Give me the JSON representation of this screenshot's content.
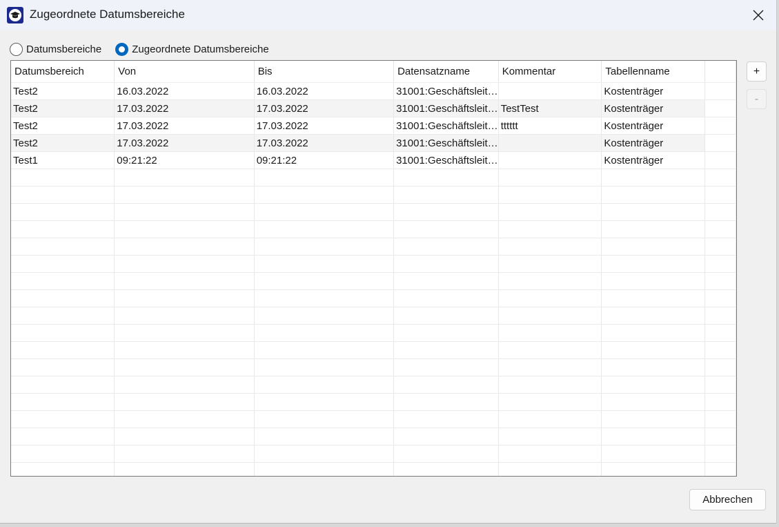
{
  "window": {
    "title": "Zugeordnete Datumsbereiche",
    "accent_color": "#0067c0"
  },
  "mode": {
    "options": [
      {
        "label": "Datumsbereiche",
        "checked": false
      },
      {
        "label": "Zugeordnete Datumsbereiche",
        "checked": true
      }
    ]
  },
  "table": {
    "columns": [
      "Datumsbereich",
      "Von",
      "Bis",
      "Datensatzname",
      "Kommentar",
      "Tabellenname"
    ],
    "rows": [
      [
        "Test2",
        "16.03.2022",
        "16.03.2022",
        "31001:Geschäftsleit…",
        "",
        "Kostenträger"
      ],
      [
        "Test2",
        "17.03.2022",
        "17.03.2022",
        "31001:Geschäftsleit…",
        "TestTest",
        "Kostenträger"
      ],
      [
        "Test2",
        "17.03.2022",
        "17.03.2022",
        "31001:Geschäftsleit…",
        "tttttt",
        "Kostenträger"
      ],
      [
        "Test2",
        "17.03.2022",
        "17.03.2022",
        "31001:Geschäftsleit…",
        "",
        "Kostenträger"
      ],
      [
        "Test1",
        "09:21:22",
        "09:21:22",
        "31001:Geschäftsleit…",
        "",
        "Kostenträger"
      ]
    ]
  },
  "buttons": {
    "add": "+",
    "remove": "-",
    "cancel": "Abbrechen"
  }
}
